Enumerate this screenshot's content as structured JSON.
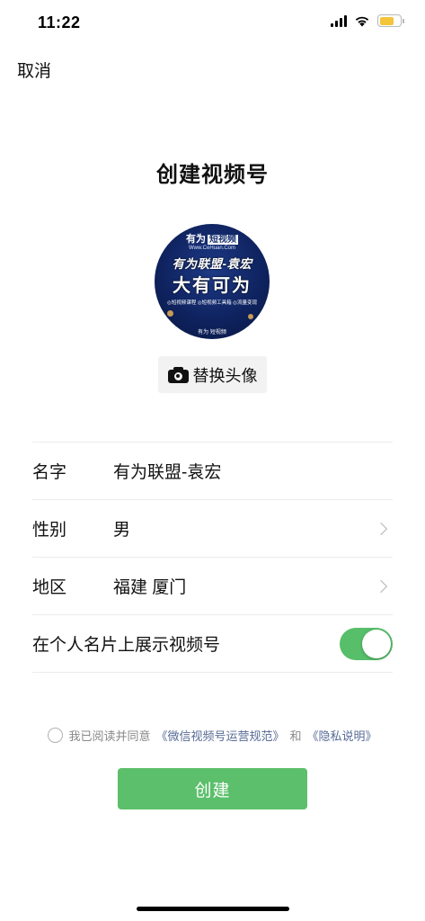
{
  "status_bar": {
    "time": "11:22",
    "battery_level": 0.7,
    "battery_color": "#f4c43a"
  },
  "nav": {
    "cancel_label": "取消"
  },
  "page": {
    "title": "创建视频号"
  },
  "avatar": {
    "line_top": "有为",
    "line_top_tag": "短视频",
    "url": "Www.CeHuan.Com",
    "line1": "有为联盟-袁宏",
    "line2": "大有可为",
    "small_text": "◎短视频课程 ◎短视频工具箱 ◎流量变现",
    "bottom_text": "有为 短视频"
  },
  "change_avatar": {
    "label": "替换头像",
    "icon": "camera-icon"
  },
  "form": {
    "name_label": "名字",
    "name_value": "有为联盟-袁宏",
    "gender_label": "性别",
    "gender_value": "男",
    "region_label": "地区",
    "region_value": "福建 厦门",
    "show_label": "在个人名片上展示视频号",
    "show_enabled": true
  },
  "agreement": {
    "prefix": "我已阅读并同意",
    "link1": "《微信视频号运营规范》",
    "middle": "和",
    "link2": "《隐私说明》"
  },
  "actions": {
    "create_label": "创建",
    "create_color": "#5bbf6b",
    "toggle_color": "#57be6a"
  }
}
